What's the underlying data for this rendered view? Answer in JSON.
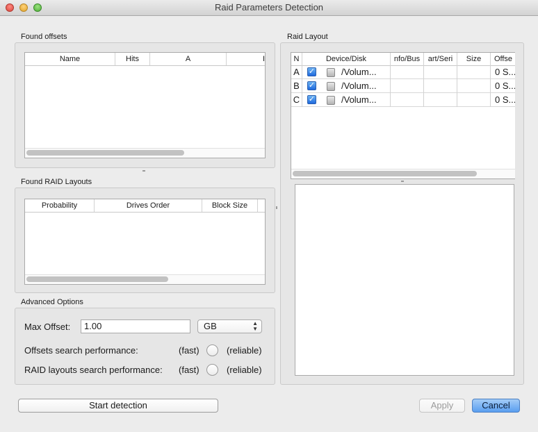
{
  "window": {
    "title": "Raid Parameters Detection"
  },
  "found_offsets": {
    "label": "Found offsets",
    "columns": [
      "Name",
      "Hits",
      "A",
      "I"
    ]
  },
  "found_raid_layouts": {
    "label": "Found RAID Layouts",
    "columns": [
      "Probability",
      "Drives Order",
      "Block Size"
    ]
  },
  "advanced_options": {
    "label": "Advanced Options",
    "max_offset_label": "Max Offset:",
    "max_offset_value": "1.00",
    "unit_selected": "GB",
    "offsets_perf_label": "Offsets search performance:",
    "raid_perf_label": "RAID layouts search performance:",
    "fast_label": "(fast)",
    "reliable_label": "(reliable)"
  },
  "raid_layout": {
    "label": "Raid Layout",
    "columns": [
      "N",
      "Device/Disk",
      "nfo/Bus",
      "art/Seri",
      "Size",
      "Offse"
    ],
    "rows": [
      {
        "n": "A",
        "device": "/Volum...",
        "offset": "0 S..."
      },
      {
        "n": "B",
        "device": "/Volum...",
        "offset": "0 S..."
      },
      {
        "n": "C",
        "device": "/Volum...",
        "offset": "0 S..."
      }
    ]
  },
  "buttons": {
    "start_detection": "Start detection",
    "apply": "Apply",
    "cancel": "Cancel"
  }
}
